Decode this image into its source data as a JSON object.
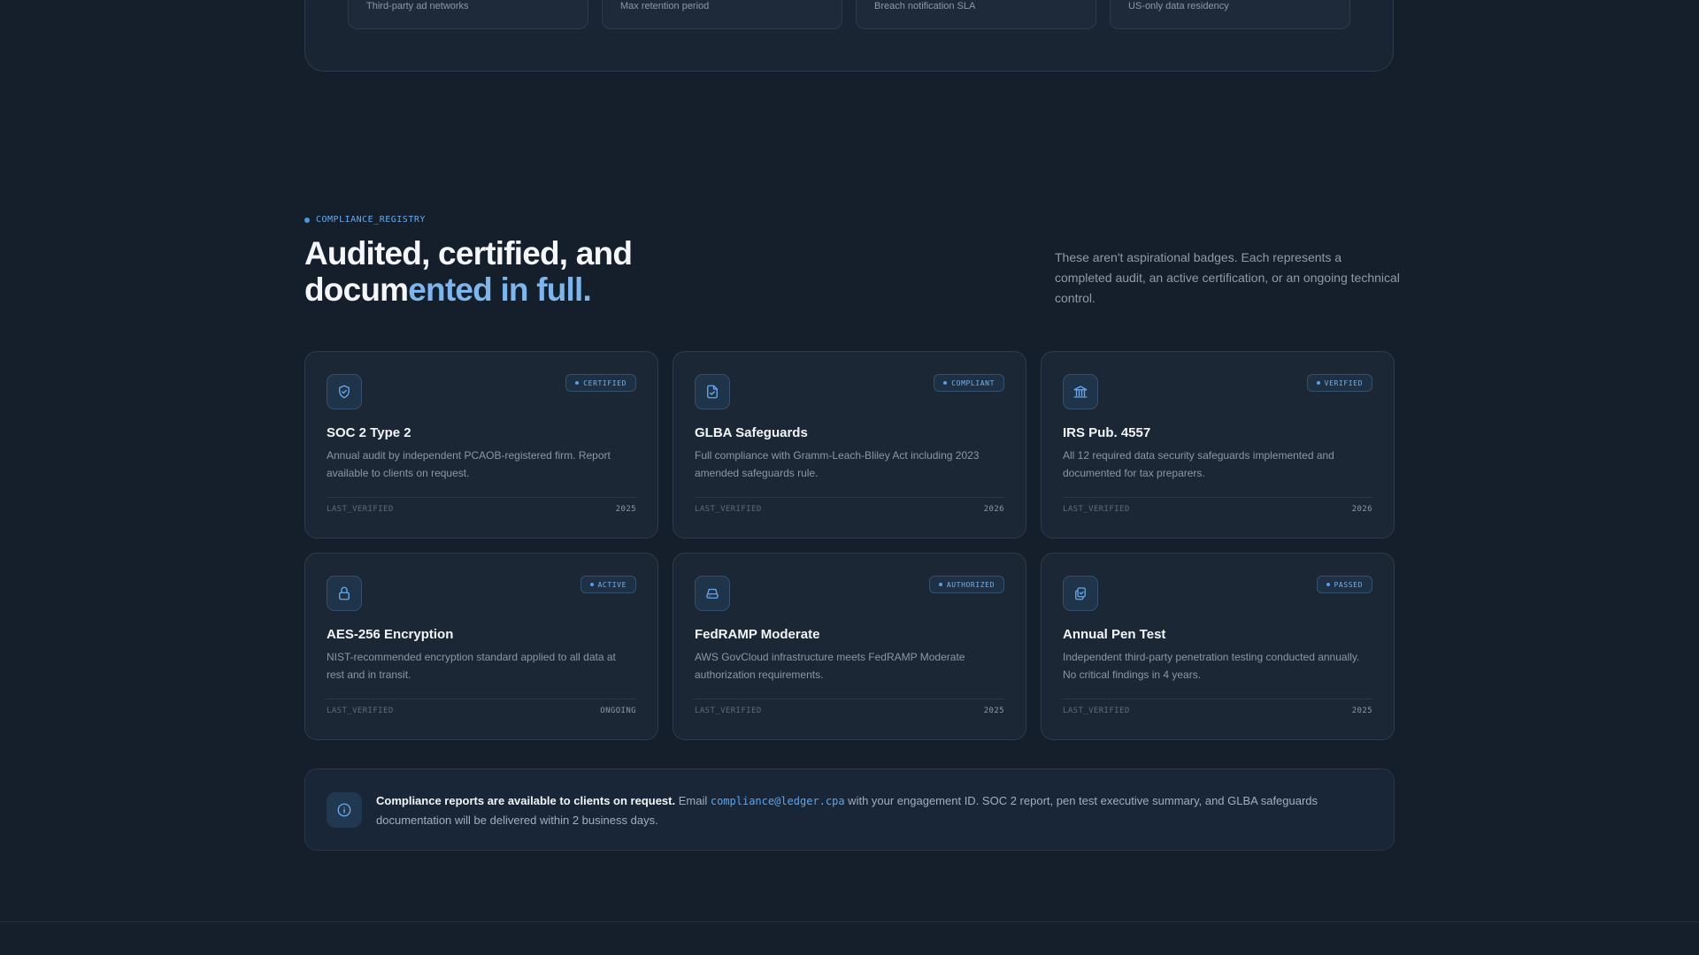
{
  "top_stats": [
    {
      "label": "Third-party ad networks"
    },
    {
      "label": "Max retention period"
    },
    {
      "label": "Breach notification SLA"
    },
    {
      "label": "US-only data residency"
    }
  ],
  "section": {
    "eyebrow": "COMPLIANCE_REGISTRY",
    "headline_line1": "Audited, certified, and",
    "headline_line2_plain": "docum",
    "headline_line2_accent": "ented in full.",
    "intro": "These aren't aspirational badges. Each represents a completed audit, an active certification, or an ongoing technical control."
  },
  "cards": [
    {
      "icon": "shield-check-icon",
      "badge": "CERTIFIED",
      "title": "SOC 2 Type 2",
      "description": "Annual audit by independent PCAOB-registered firm. Report available to clients on request.",
      "footer_label": "LAST_VERIFIED",
      "footer_value": "2025"
    },
    {
      "icon": "document-check-icon",
      "badge": "COMPLIANT",
      "title": "GLBA Safeguards",
      "description": "Full compliance with Gramm-Leach-Bliley Act including 2023 amended safeguards rule.",
      "footer_label": "LAST_VERIFIED",
      "footer_value": "2026"
    },
    {
      "icon": "bank-building-icon",
      "badge": "VERIFIED",
      "title": "IRS Pub. 4557",
      "description": "All 12 required data security safeguards implemented and documented for tax preparers.",
      "footer_label": "LAST_VERIFIED",
      "footer_value": "2026"
    },
    {
      "icon": "lock-icon",
      "badge": "ACTIVE",
      "title": "AES-256 Encryption",
      "description": "NIST-recommended encryption standard applied to all data at rest and in transit.",
      "footer_label": "LAST_VERIFIED",
      "footer_value": "ONGOING"
    },
    {
      "icon": "server-drive-icon",
      "badge": "AUTHORIZED",
      "title": "FedRAMP Moderate",
      "description": "AWS GovCloud infrastructure meets FedRAMP Moderate authorization requirements.",
      "footer_label": "LAST_VERIFIED",
      "footer_value": "2025"
    },
    {
      "icon": "clipboard-copy-icon",
      "badge": "PASSED",
      "title": "Annual Pen Test",
      "description": "Independent third-party penetration testing conducted annually. No critical findings in 4 years.",
      "footer_label": "LAST_VERIFIED",
      "footer_value": "2025"
    }
  ],
  "notice": {
    "icon": "info-icon",
    "bold": "Compliance reports are available to clients on request.",
    "pre_email": " Email ",
    "email": "compliance@ledger.cpa",
    "post_email": " with your engagement ID. SOC 2 report, pen test executive summary, and GLBA safeguards documentation will be delivered within 2 business days."
  },
  "colors": {
    "background": "#151f2b",
    "card": "#1c2735",
    "accent": "#7db5ec",
    "accent_strong": "#5aa6ee"
  }
}
